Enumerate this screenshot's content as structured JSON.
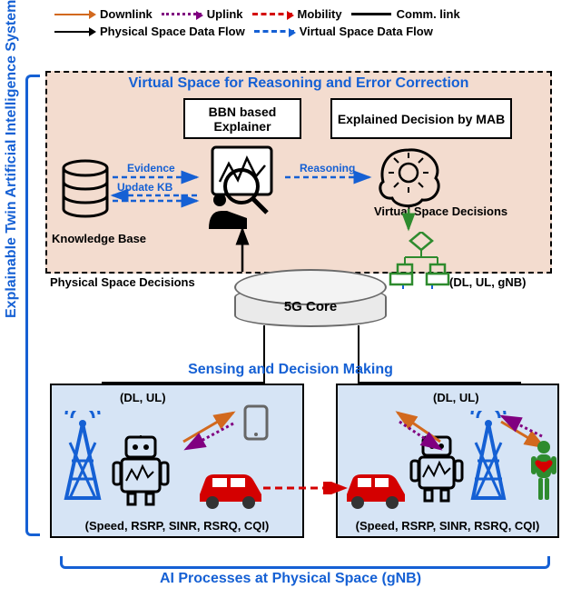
{
  "legend": {
    "downlink": "Downlink",
    "uplink": "Uplink",
    "mobility": "Mobility",
    "commlink": "Comm. link",
    "physflow": "Physical Space Data Flow",
    "virtflow": "Virtual Space Data Flow"
  },
  "vertical_label": "Explainable Twin Artificial Intelligence Systems",
  "virtual": {
    "title": "Virtual Space for Reasoning and Error Correction",
    "bbn": "BBN based Explainer",
    "mab": "Explained Decision by MAB",
    "kb": "Knowledge Base",
    "evidence": "Evidence",
    "update_kb": "Update KB",
    "reasoning": "Reasoning",
    "vs_decisions": "Virtual Space Decisions"
  },
  "ps_decisions": "Physical Space Decisions",
  "dl_ul_gnb": "(DL, UL, gNB)",
  "core": "5G Core",
  "phys_title": "Sensing and Decision Making",
  "phys": {
    "dl_ul": "(DL, UL)",
    "params": "(Speed, RSRP, SINR, RSRQ, CQI)"
  },
  "bottom_label": "AI Processes at Physical Space (gNB)",
  "icons": {
    "database": "database-icon",
    "investigator": "magnifier-person-icon",
    "brain": "idea-brain-icon",
    "flowchart": "flowchart-icon",
    "outbox": "output-box-icon",
    "tower": "cell-tower-icon",
    "robot": "robot-icon",
    "car": "car-icon",
    "phone": "smartphone-icon",
    "human": "human-heart-icon"
  },
  "colors": {
    "blue": "#1560d4",
    "orange": "#d2691e",
    "purple": "#800080",
    "red": "#d40000",
    "green": "#2e8b2e",
    "virtual_bg": "#f3dccf",
    "phys_bg": "#d6e4f5"
  }
}
